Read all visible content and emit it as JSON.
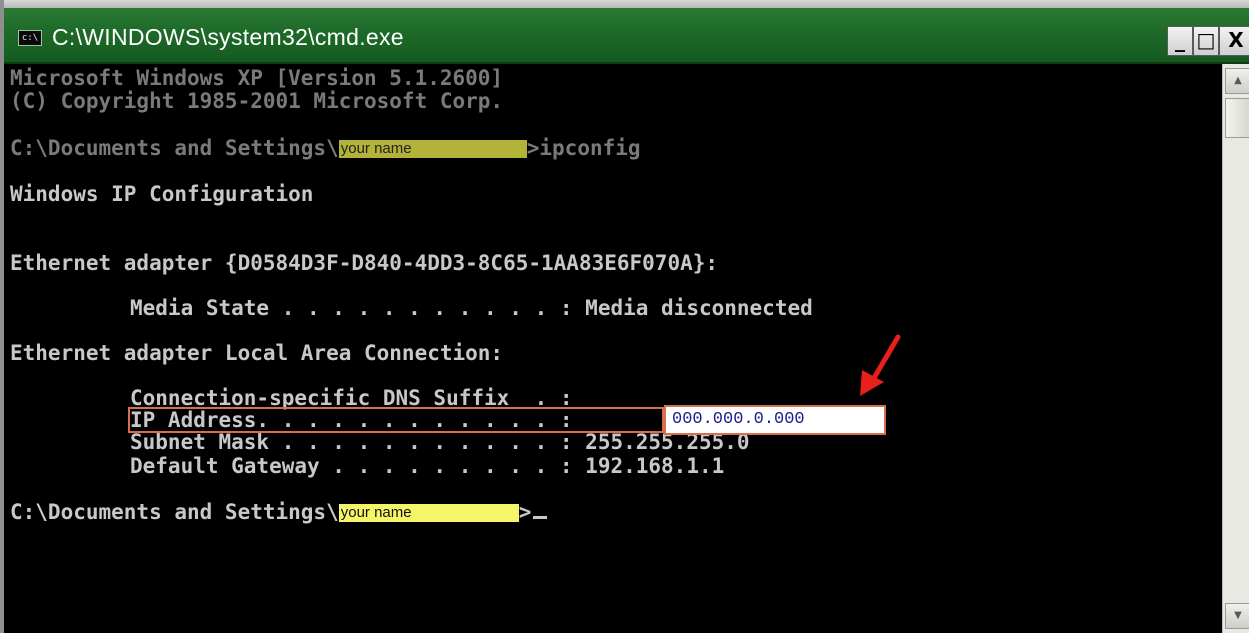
{
  "window": {
    "title": "C:\\WINDOWS\\system32\\cmd.exe",
    "icon": "cmd-icon",
    "controls": {
      "minimize": "_",
      "maximize": "□",
      "close": "X"
    }
  },
  "console": {
    "version_line": "Microsoft Windows XP [Version 5.1.2600]",
    "copyright_line": "(C) Copyright 1985-2001 Microsoft Corp.",
    "prompt_path": "C:\\Documents and Settings\\",
    "user_placeholder": "your name",
    "prompt_suffix": ">",
    "command": "ipconfig",
    "heading": "Windows IP Configuration",
    "adapter1_header": "Ethernet adapter {D0584D3F-D840-4DD3-8C65-1AA83E6F070A}:",
    "media_state_label": "Media State . . . . . . . . . . . :",
    "media_state_value": "Media disconnected",
    "adapter2_header": "Ethernet adapter Local Area Connection:",
    "dns_suffix_label": "Connection-specific DNS Suffix  . :",
    "ip_label": "IP Address. . . . . . . . . . . . :",
    "ip_value": "000.000.0.000",
    "subnet_label": "Subnet Mask . . . . . . . . . . . :",
    "subnet_value": "255.255.255.0",
    "gateway_label": "Default Gateway . . . . . . . . . :",
    "gateway_value": "192.168.1.1"
  },
  "colors": {
    "highlight": "#f5f56a",
    "annotation": "#d66f4a",
    "arrow": "#e8201c"
  }
}
